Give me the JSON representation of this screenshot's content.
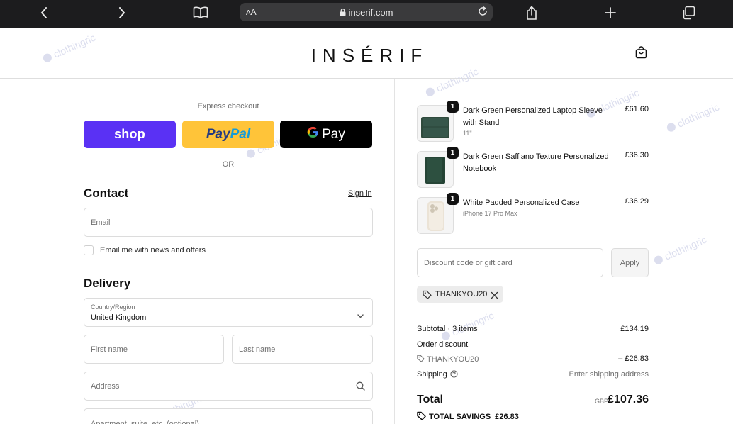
{
  "browser": {
    "aa_label": "AA",
    "url": "inserif.com"
  },
  "store": {
    "logo": "INSÉRIF"
  },
  "watermark": "clothingric",
  "checkout": {
    "express_label": "Express checkout",
    "shop_label": "shop",
    "paypal_label_a": "Pay",
    "paypal_label_b": "Pal",
    "gpay_g": "G",
    "gpay_label": "Pay",
    "or_label": "OR",
    "contact": {
      "title": "Contact",
      "sign_in": "Sign in",
      "email_placeholder": "Email",
      "newsletter_label": "Email me with news and offers"
    },
    "delivery": {
      "title": "Delivery",
      "country_caption": "Country/Region",
      "country_value": "United Kingdom",
      "first_name_placeholder": "First name",
      "last_name_placeholder": "Last name",
      "address_placeholder": "Address",
      "apartment_placeholder": "Apartment, suite, etc. (optional)"
    }
  },
  "cart": {
    "items": [
      {
        "name": "Dark Green Personalized Laptop Sleeve with Stand",
        "variant": "11\"",
        "price": "£61.60",
        "qty": "1"
      },
      {
        "name": "Dark Green Saffiano Texture Personalized Notebook",
        "variant": "",
        "price": "£36.30",
        "qty": "1"
      },
      {
        "name": "White Padded Personalized Case",
        "variant": "iPhone 17 Pro Max",
        "price": "£36.29",
        "qty": "1"
      }
    ],
    "discount_placeholder": "Discount code or gift card",
    "apply_label": "Apply",
    "applied_code": "THANKYOU20",
    "summary": {
      "subtotal_label": "Subtotal · 3 items",
      "subtotal_value": "£134.19",
      "order_discount_label": "Order discount",
      "discount_code": "THANKYOU20",
      "discount_value": "– £26.83",
      "shipping_label": "Shipping",
      "shipping_value": "Enter shipping address",
      "total_label": "Total",
      "total_currency": "GBP",
      "total_value": "£107.36",
      "savings_label": "TOTAL SAVINGS",
      "savings_value": "£26.83"
    }
  },
  "colors": {
    "shop_pay": "#5a31f4",
    "paypal": "#ffc439",
    "gpay": "#000000",
    "toolbar": "#1c1c1e"
  }
}
